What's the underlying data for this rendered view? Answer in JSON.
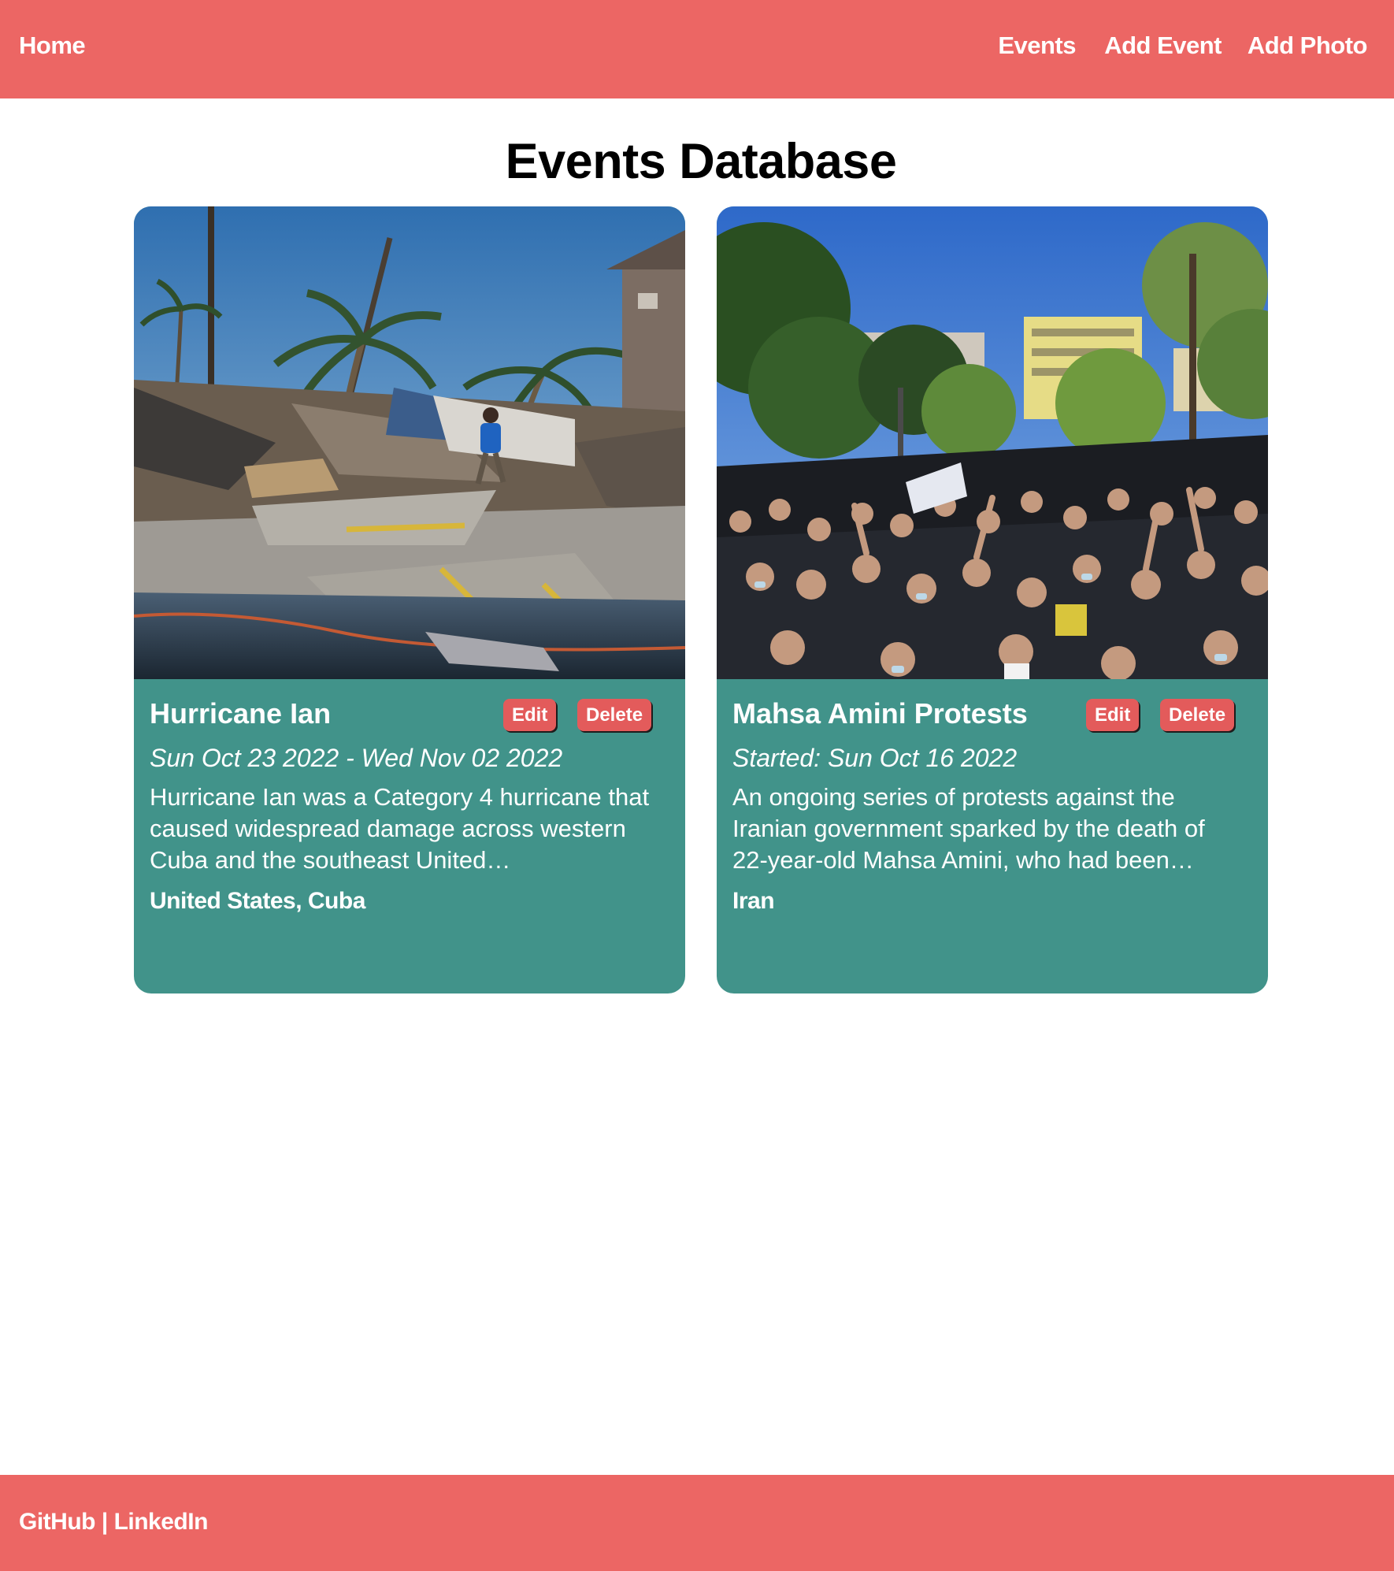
{
  "nav": {
    "home": "Home",
    "events": "Events",
    "add_event": "Add Event",
    "add_photo": "Add Photo"
  },
  "page_title": "Events Database",
  "colors": {
    "header_bg": "#ec6664",
    "card_bg": "#41938a",
    "button_bg": "#e35b5b",
    "text_on_color": "#ffffff"
  },
  "events": [
    {
      "title": "Hurricane Ian",
      "dates": "Sun Oct 23 2022 - Wed Nov 02 2022",
      "description": "Hurricane Ian was a Category 4 hurricane that caused widespread damage across western Cuba and the southeast United…",
      "location": "United States, Cuba",
      "photo_icon": "hurricane-damage-photo",
      "edit_label": "Edit",
      "delete_label": "Delete"
    },
    {
      "title": "Mahsa Amini Protests",
      "dates": "Started: Sun Oct 16 2022",
      "description": "An ongoing series of protests against the Iranian government sparked by the death of 22-year-old Mahsa Amini, who had been…",
      "location": "Iran",
      "photo_icon": "protest-crowd-photo",
      "edit_label": "Edit",
      "delete_label": "Delete"
    }
  ],
  "footer": {
    "github": "GitHub",
    "separator": " | ",
    "linkedin": "LinkedIn"
  }
}
